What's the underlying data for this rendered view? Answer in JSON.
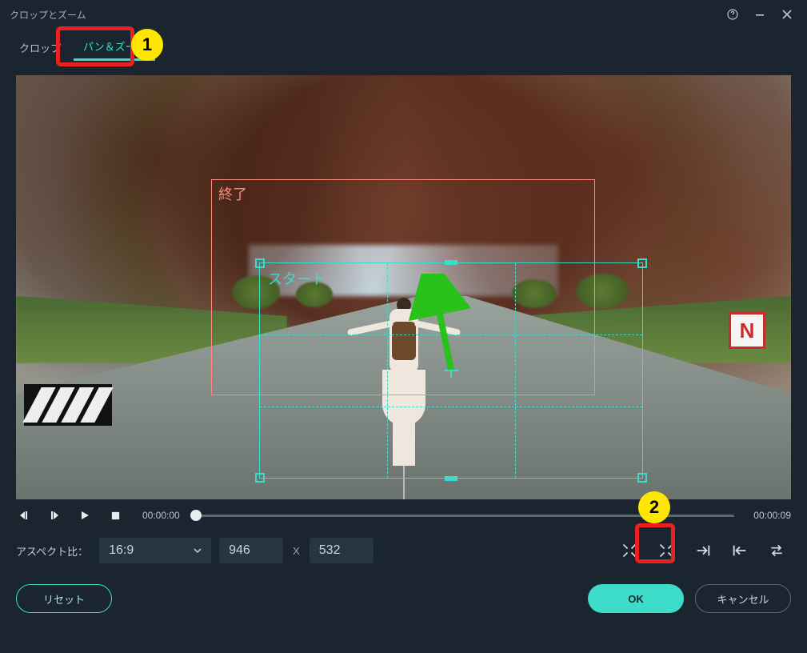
{
  "window": {
    "title": "クロップとズーム"
  },
  "tabs": {
    "crop": "クロップ",
    "panzoom": "パン＆ズーム"
  },
  "rects": {
    "end_label": "終了",
    "start_label": "スタート"
  },
  "playbar": {
    "time_current": "00:00:00",
    "time_total": "00:00:09"
  },
  "aspect": {
    "label": "アスペクト比：",
    "value": "16:9",
    "width": "946",
    "sep": "X",
    "height": "532"
  },
  "buttons": {
    "reset": "リセット",
    "ok": "OK",
    "cancel": "キャンセル"
  },
  "callouts": {
    "one": "1",
    "two": "2"
  }
}
